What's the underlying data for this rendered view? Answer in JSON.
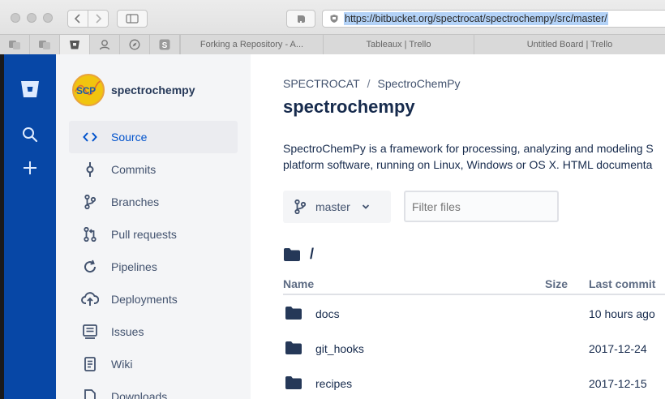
{
  "browser": {
    "url": "https://bitbucket.org/spectrocat/spectrochempy/src/master/",
    "tabs": [
      "Forking a Repository - A...",
      "Tableaux | Trello",
      "Untitled Board | Trello"
    ]
  },
  "sidebar": {
    "repo_name": "spectrochempy",
    "avatar_text": "SCP",
    "items": [
      {
        "label": "Source",
        "icon": "source-icon"
      },
      {
        "label": "Commits",
        "icon": "commit-icon"
      },
      {
        "label": "Branches",
        "icon": "branch-icon"
      },
      {
        "label": "Pull requests",
        "icon": "pull-request-icon"
      },
      {
        "label": "Pipelines",
        "icon": "pipelines-icon"
      },
      {
        "label": "Deployments",
        "icon": "cloud-upload-icon"
      },
      {
        "label": "Issues",
        "icon": "issues-icon"
      },
      {
        "label": "Wiki",
        "icon": "wiki-icon"
      },
      {
        "label": "Downloads",
        "icon": "downloads-icon"
      }
    ]
  },
  "main": {
    "breadcrumb": {
      "owner": "SPECTROCAT",
      "separator": "/",
      "repo": "SpectroChemPy"
    },
    "title": "spectrochempy",
    "description_line1": "SpectroChemPy is a framework for processing, analyzing and modeling S",
    "description_line2": "platform software, running on Linux, Windows or OS X. HTML documenta",
    "branch": "master",
    "filter_placeholder": "Filter files",
    "path": "/",
    "columns": {
      "name": "Name",
      "size": "Size",
      "last_commit": "Last commit"
    },
    "files": [
      {
        "name": "docs",
        "last_commit": "10 hours ago"
      },
      {
        "name": "git_hooks",
        "last_commit": "2017-12-24"
      },
      {
        "name": "recipes",
        "last_commit": "2017-12-15"
      }
    ]
  },
  "colors": {
    "bitbucket_blue": "#0747a6",
    "link_blue": "#0052cc",
    "text_dark": "#172b4d"
  }
}
